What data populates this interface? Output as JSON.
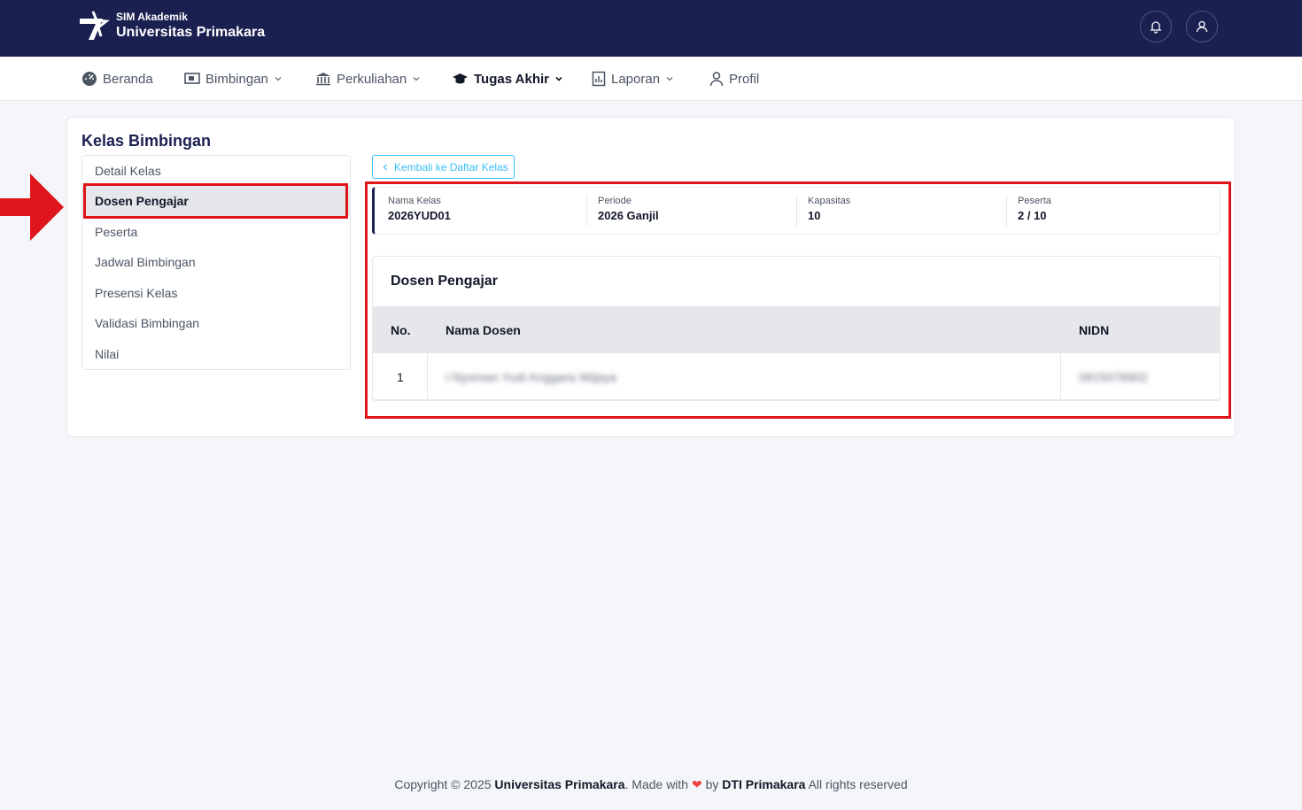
{
  "header": {
    "brand_sub": "SIM Akademik",
    "brand_main": "Universitas Primakara"
  },
  "nav": {
    "items": [
      {
        "label": "Beranda",
        "icon": "dashboard-icon"
      },
      {
        "label": "Bimbingan",
        "icon": "presentation-icon"
      },
      {
        "label": "Perkuliahan",
        "icon": "building-icon"
      },
      {
        "label": "Tugas Akhir",
        "icon": "graduation-cap-icon"
      },
      {
        "label": "Laporan",
        "icon": "report-icon"
      },
      {
        "label": "Profil",
        "icon": "user-icon"
      }
    ]
  },
  "page": {
    "title": "Kelas Bimbingan",
    "menu": [
      "Detail Kelas",
      "Dosen Pengajar",
      "Peserta",
      "Jadwal Bimbingan",
      "Presensi Kelas",
      "Validasi Bimbingan",
      "Nilai"
    ],
    "active_menu": "Dosen Pengajar",
    "back_label": "Kembali ke Daftar Kelas"
  },
  "info": [
    {
      "label": "Nama Kelas",
      "value": "2026YUD01"
    },
    {
      "label": "Periode",
      "value": "2026 Ganjil"
    },
    {
      "label": "Kapasitas",
      "value": "10"
    },
    {
      "label": "Peserta",
      "value": "2 / 10"
    }
  ],
  "dosen": {
    "title": "Dosen Pengajar",
    "columns": [
      "No.",
      "Nama Dosen",
      "NIDN"
    ],
    "rows": [
      {
        "no": "1",
        "nama": "I Nyoman Yudi Anggara Wijaya",
        "nidn": "0815078902"
      }
    ]
  },
  "footer": {
    "prefix": "Copyright © 2025 ",
    "org": "Universitas Primakara",
    "made": ". Made with ",
    "by": " by ",
    "team": "DTI Primakara",
    "suffix": " All rights reserved"
  },
  "colors": {
    "header_bg": "#1a2151",
    "highlight": "#e0141b",
    "accent": "#38bdf8"
  }
}
